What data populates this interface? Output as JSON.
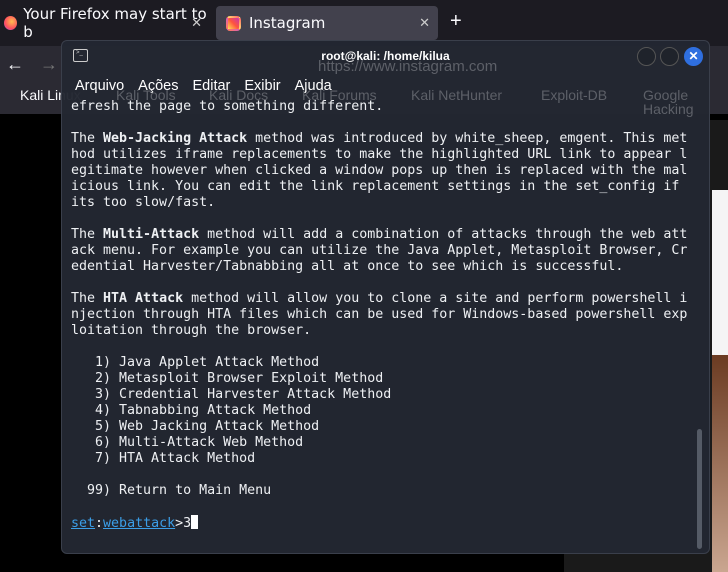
{
  "browser": {
    "tabs": [
      {
        "label": "Your Firefox may start to b"
      },
      {
        "label": "Instagram"
      }
    ],
    "url": "https://www.instagram.com",
    "bookmarks": [
      "Kali Linux",
      "Kali Tools",
      "Kali Docs",
      "Kali Forums",
      "Kali NetHunter",
      "Exploit-DB",
      "Google Hacking"
    ]
  },
  "terminal": {
    "title": "root@kali: /home/kilua",
    "menu": [
      "Arquivo",
      "Ações",
      "Editar",
      "Exibir",
      "Ajuda"
    ],
    "lines": [
      "efresh the page to something different.",
      "",
      [
        [
          "The ",
          ""
        ],
        [
          "Web-Jacking Attack",
          "b"
        ],
        [
          " method was introduced by white_sheep, emgent. This met",
          ""
        ]
      ],
      "hod utilizes iframe replacements to make the highlighted URL link to appear l",
      "egitimate however when clicked a window pops up then is replaced with the mal",
      "icious link. You can edit the link replacement settings in the set_config if",
      "its too slow/fast.",
      "",
      [
        [
          "The ",
          ""
        ],
        [
          "Multi-Attack",
          "b"
        ],
        [
          " method will add a combination of attacks through the web att",
          ""
        ]
      ],
      "ack menu. For example you can utilize the Java Applet, Metasploit Browser, Cr",
      "edential Harvester/Tabnabbing all at once to see which is successful.",
      "",
      [
        [
          "The ",
          ""
        ],
        [
          "HTA Attack",
          "b"
        ],
        [
          " method will allow you to clone a site and perform powershell i",
          ""
        ]
      ],
      "njection through HTA files which can be used for Windows-based powershell exp",
      "loitation through the browser.",
      "",
      "   1) Java Applet Attack Method",
      "   2) Metasploit Browser Exploit Method",
      "   3) Credential Harvester Attack Method",
      "   4) Tabnabbing Attack Method",
      "   5) Web Jacking Attack Method",
      "   6) Multi-Attack Web Method",
      "   7) HTA Attack Method",
      "",
      "  99) Return to Main Menu",
      ""
    ],
    "prompt": {
      "set": "set",
      "sep": ":",
      "module": "webattack",
      "gt": ">",
      "input": "3"
    }
  }
}
